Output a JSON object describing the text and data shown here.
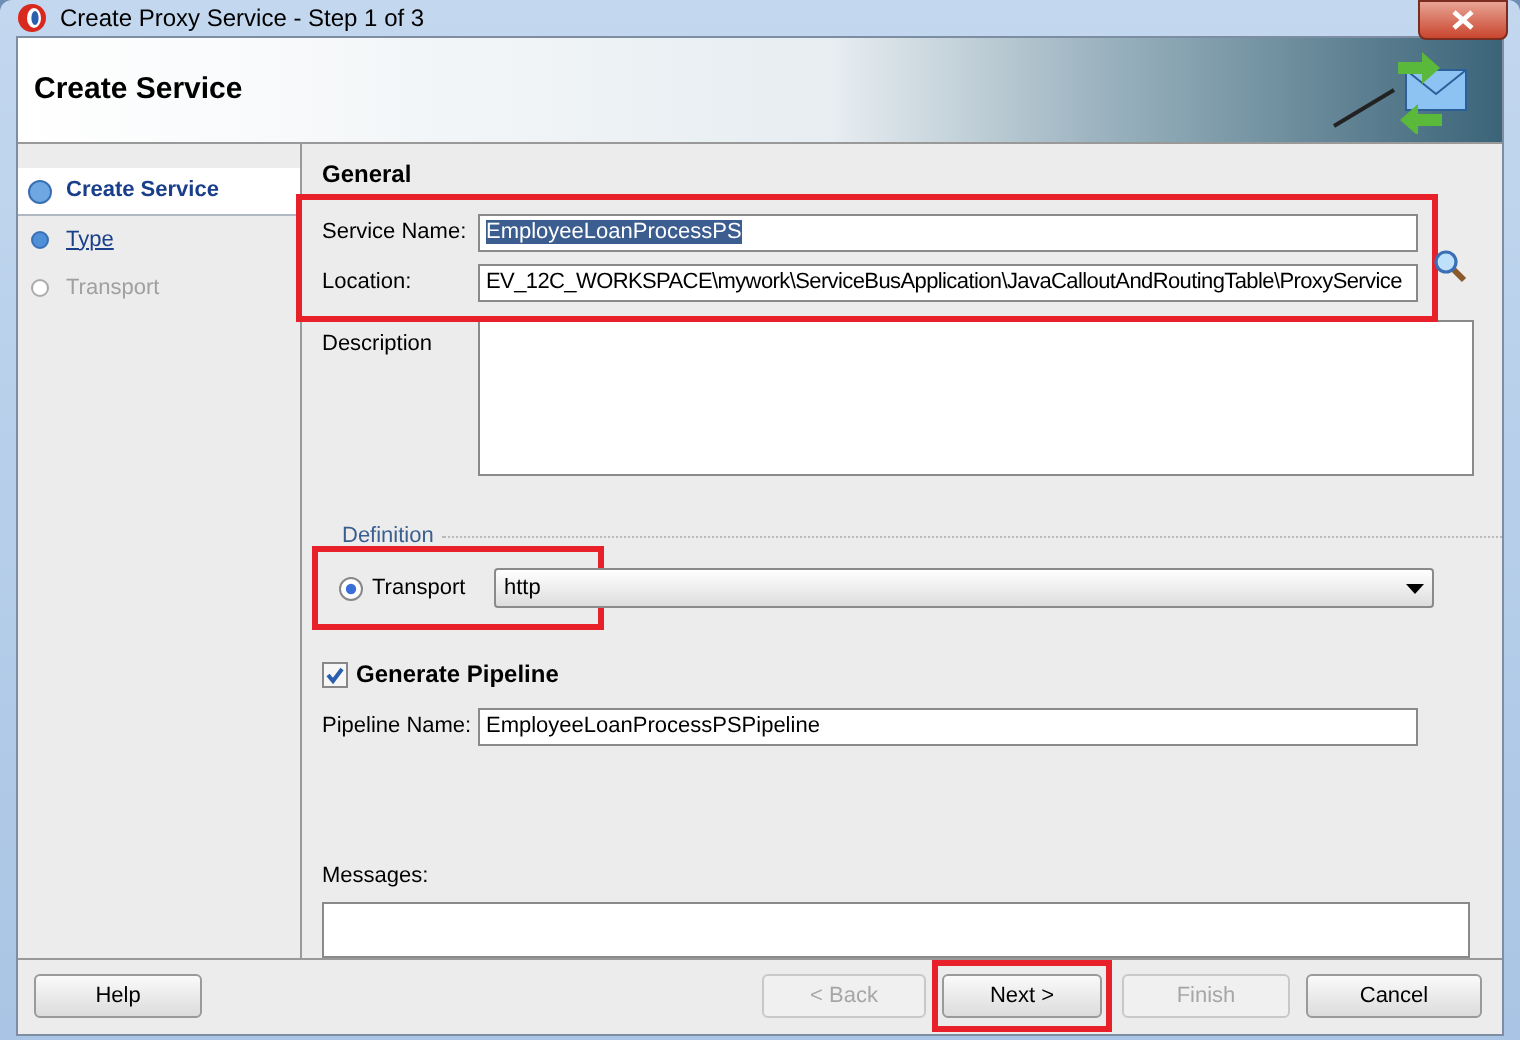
{
  "window": {
    "title": "Create Proxy Service - Step 1 of 3"
  },
  "header": {
    "title": "Create Service"
  },
  "steps": [
    {
      "label": "Create Service",
      "selected": true,
      "disabled": false
    },
    {
      "label": "Type",
      "selected": false,
      "disabled": false
    },
    {
      "label": "Transport",
      "selected": false,
      "disabled": true
    }
  ],
  "general": {
    "heading": "General",
    "highlighted": true,
    "service_name": {
      "label": "Service Name:",
      "value": "EmployeeLoanProcessPS",
      "selected": true
    },
    "location": {
      "label": "Location:",
      "value": "EV_12C_WORKSPACE\\mywork\\ServiceBusApplication\\JavaCalloutAndRoutingTable\\ProxyService"
    },
    "description": {
      "label": "Description"
    }
  },
  "definition": {
    "heading": "Definition",
    "option": {
      "label": "Transport",
      "selected": true,
      "highlighted": true
    },
    "value": "http"
  },
  "pipeline": {
    "checkbox": {
      "label": "Generate Pipeline",
      "checked": true
    },
    "name_label": "Pipeline Name:",
    "name_value": "EmployeeLoanProcessPSPipeline"
  },
  "messages": {
    "label": "Messages:"
  },
  "buttons": [
    {
      "label": "Help",
      "disabled": false,
      "highlighted": false
    },
    {
      "label": "< Back",
      "disabled": true,
      "highlighted": false
    },
    {
      "label": "Next >",
      "disabled": false,
      "highlighted": true
    },
    {
      "label": "Finish",
      "disabled": true,
      "highlighted": false
    },
    {
      "label": "Cancel",
      "disabled": false,
      "highlighted": false
    }
  ]
}
